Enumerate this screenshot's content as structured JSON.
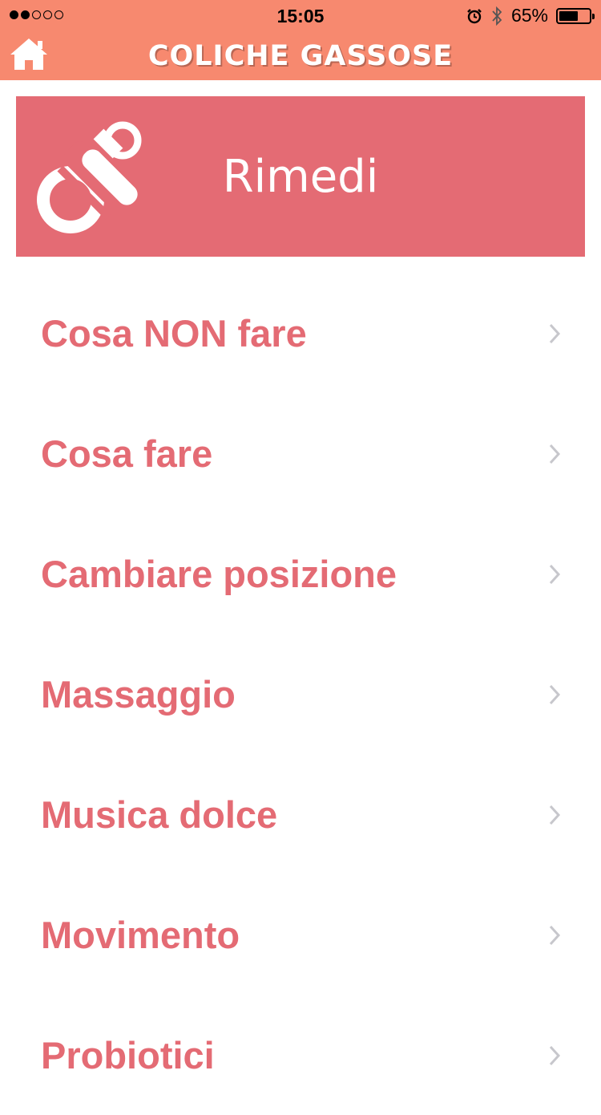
{
  "status_bar": {
    "time": "15:05",
    "battery_percent": "65%",
    "battery_level": 0.65,
    "signal_strength": 2,
    "signal_total": 5
  },
  "nav": {
    "title": "COLICHE GASSOSE",
    "home_icon": "home-icon"
  },
  "header": {
    "title": "Rimedi",
    "icon": "pacifier-icon"
  },
  "menu": {
    "items": [
      {
        "label": "Cosa NON fare"
      },
      {
        "label": "Cosa fare"
      },
      {
        "label": "Cambiare posizione"
      },
      {
        "label": "Massaggio"
      },
      {
        "label": "Musica dolce"
      },
      {
        "label": "Movimento"
      },
      {
        "label": "Probiotici"
      }
    ]
  },
  "colors": {
    "bar": "#f7896f",
    "accent": "#e46b74",
    "chevron": "#c7c7cc"
  }
}
